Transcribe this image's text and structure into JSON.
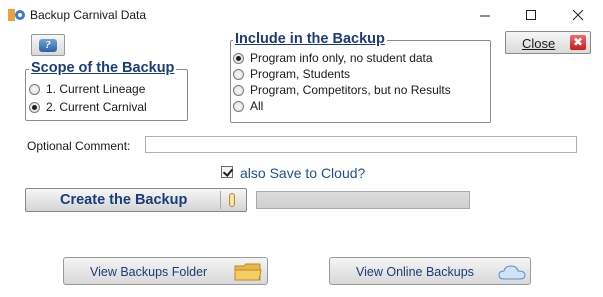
{
  "window": {
    "title": "Backup Carnival Data",
    "controls": {
      "minimize": "—",
      "maximize": "☐",
      "close": "✕"
    }
  },
  "help_button": {
    "icon": "help-icon",
    "glyph": "?"
  },
  "close_button": {
    "label": "Close",
    "icon": "close-x-icon",
    "glyph": "✖"
  },
  "scope_group": {
    "legend": "Scope of the Backup",
    "options": [
      {
        "label": "1. Current Lineage",
        "checked": false
      },
      {
        "label": "2. Current Carnival",
        "checked": true
      }
    ]
  },
  "include_group": {
    "legend": "Include in the Backup",
    "options": [
      {
        "label": "Program info only, no student data",
        "checked": true
      },
      {
        "label": "Program, Students",
        "checked": false
      },
      {
        "label": "Program, Competitors, but no Results",
        "checked": false
      },
      {
        "label": "All",
        "checked": false
      }
    ]
  },
  "comment": {
    "label": "Optional Comment:",
    "value": ""
  },
  "cloud": {
    "label": "also Save to Cloud?",
    "checked": true
  },
  "create_backup": {
    "label": "Create the Backup",
    "icon": "thermometer-icon",
    "progress": 0
  },
  "bottom_buttons": {
    "view_folder": {
      "label": "View Backups Folder",
      "icon": "folder-icon"
    },
    "view_online": {
      "label": "View Online Backups",
      "icon": "cloud-icon"
    }
  },
  "colors": {
    "accent": "#1b3c7a",
    "link": "#1f4f8f"
  }
}
